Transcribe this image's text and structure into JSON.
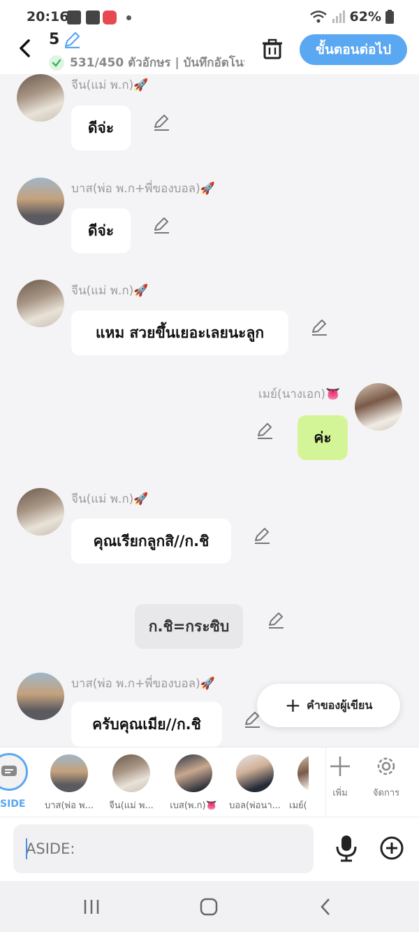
{
  "status": {
    "time": "20:16",
    "battery": "62%"
  },
  "header": {
    "episode": "5",
    "save_status": "531/450 ตัวอักษร | บันทึกอัตโนมัติ",
    "next_label": "ขั้นตอนต่อไป"
  },
  "chat": {
    "messages": [
      {
        "name": "จีน(แม่ พ.ก)🚀",
        "text": "ดีจ่ะ"
      },
      {
        "name": "บาส(พ่อ พ.ก+พี่ของบอล)🚀",
        "text": "ดีจ่ะ"
      },
      {
        "name": "จีน(แม่ พ.ก)🚀",
        "text": "แหม สวยขึ้นเยอะเลยนะลูก"
      },
      {
        "name": "เมย์(นางเอก)👅",
        "text": "ค่ะ"
      },
      {
        "name": "จีน(แม่ พ.ก)🚀",
        "text": "คุณเรียกลูกสิ//ก.ชิ"
      },
      {
        "name": "",
        "text": "ก.ชิ=กระซิบ"
      },
      {
        "name": "บาส(พ่อ พ.ก+พี่ของบอล)🚀",
        "text": "ครับคุณเมีย//ก.ชิ"
      }
    ],
    "fab_label": "คำของผู้เขียน"
  },
  "charbar": {
    "aside_label": "SIDE",
    "characters": [
      {
        "label": "บาส(พ่อ พ..."
      },
      {
        "label": "จีน(แม่ พ..."
      },
      {
        "label": "เบส(พ.ก)👅"
      },
      {
        "label": "บอล(พ่อนา..."
      },
      {
        "label": "เมย์("
      }
    ],
    "add_label": "เพิ่ม",
    "manage_label": "จัดการ"
  },
  "input": {
    "placeholder": "ASIDE:"
  },
  "colors": {
    "accent": "#5aa7f2",
    "green_bubble": "#d4f597",
    "narration_bubble": "#e8e8ea"
  }
}
